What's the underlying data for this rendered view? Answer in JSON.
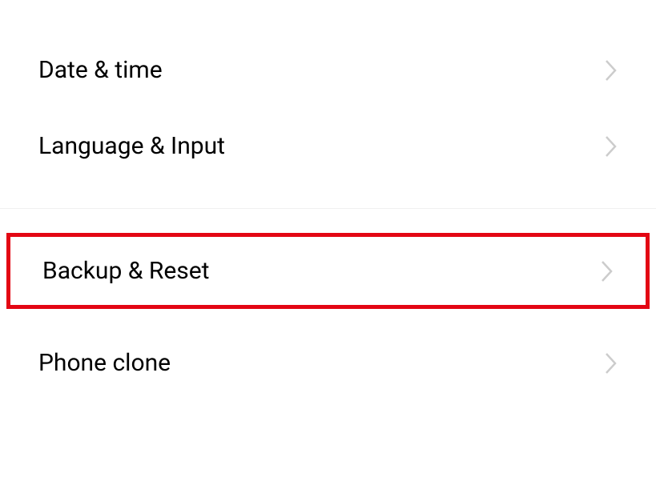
{
  "settings": {
    "items": [
      {
        "label": "Date & time"
      },
      {
        "label": "Language & Input"
      },
      {
        "label": "Backup & Reset"
      },
      {
        "label": "Phone clone"
      }
    ]
  }
}
